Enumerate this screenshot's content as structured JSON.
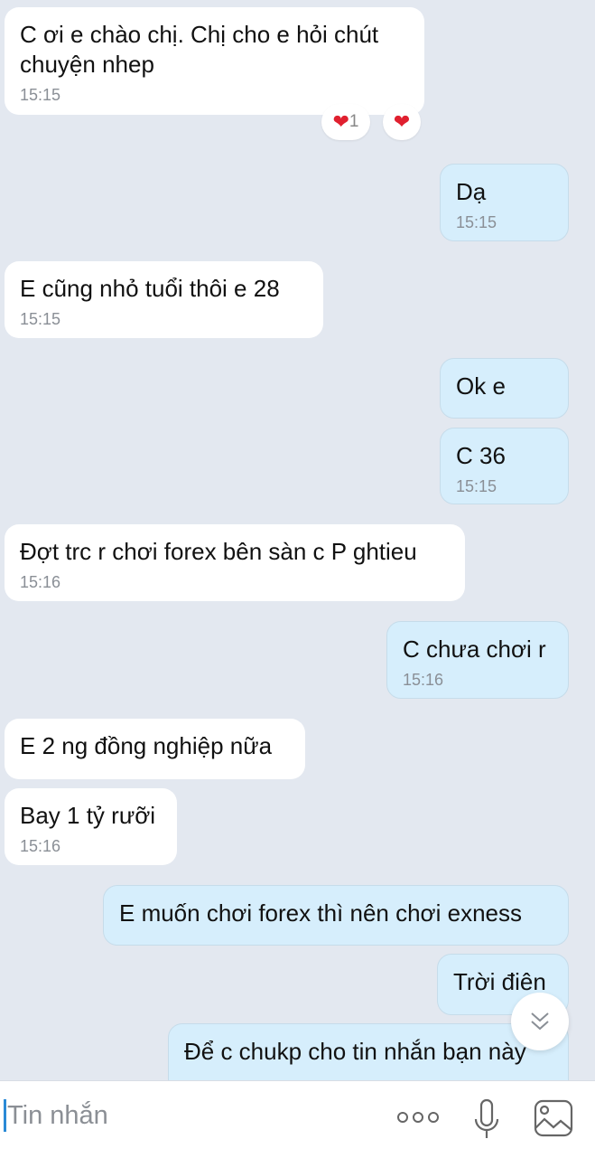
{
  "messages": [
    {
      "side": "received",
      "lines": [
        "C ơi e chào chị. Chị cho e hỏi chút",
        "chuyện nhep"
      ],
      "time": "15:15",
      "reactions": {
        "count": "1"
      }
    },
    {
      "side": "sent",
      "text": "Dạ",
      "time": "15:15"
    },
    {
      "side": "received",
      "text": "E cũng nhỏ tuổi thôi e 28",
      "time": "15:15"
    },
    {
      "side": "sent",
      "text": "Ok e"
    },
    {
      "side": "sent",
      "text": "C 36",
      "time": "15:15"
    },
    {
      "side": "received",
      "text": "Đợt trc r chơi forex bên sàn c P ghtieu",
      "time": "15:16"
    },
    {
      "side": "sent",
      "text": "C chưa chơi r",
      "time": "15:16"
    },
    {
      "side": "received",
      "text": "E 2 ng đồng nghiệp nữa"
    },
    {
      "side": "received",
      "text": "Bay 1 tỷ rưỡi",
      "time": "15:16"
    },
    {
      "side": "sent",
      "text": "E muốn chơi forex thì nên chơi exness"
    },
    {
      "side": "sent",
      "text": "Trời điên"
    },
    {
      "side": "sent",
      "text": "Để c chukp cho tin nhắn bạn này"
    }
  ],
  "composer": {
    "placeholder": "Tin nhắn",
    "icons": [
      "more-icon",
      "microphone-icon",
      "image-icon"
    ]
  },
  "colors": {
    "background": "#e3e8f0",
    "sent_bubble": "#d6eefc",
    "received_bubble": "#ffffff",
    "reaction": "#e0202f"
  }
}
